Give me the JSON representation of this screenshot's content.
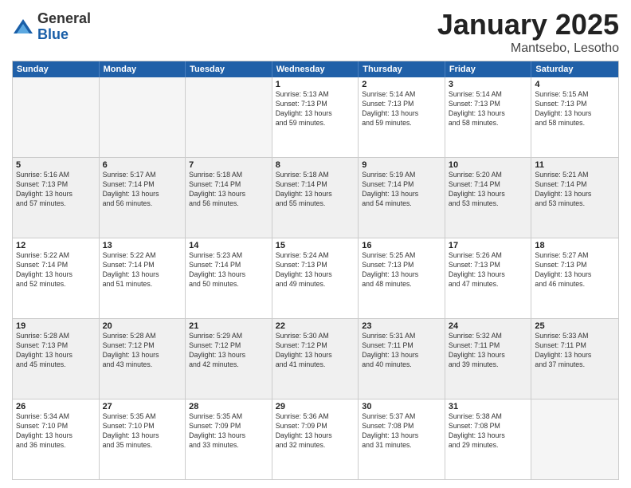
{
  "logo": {
    "general": "General",
    "blue": "Blue"
  },
  "header": {
    "month": "January 2025",
    "location": "Mantsebo, Lesotho"
  },
  "weekdays": [
    "Sunday",
    "Monday",
    "Tuesday",
    "Wednesday",
    "Thursday",
    "Friday",
    "Saturday"
  ],
  "weeks": [
    [
      {
        "day": "",
        "info": ""
      },
      {
        "day": "",
        "info": ""
      },
      {
        "day": "",
        "info": ""
      },
      {
        "day": "1",
        "info": "Sunrise: 5:13 AM\nSunset: 7:13 PM\nDaylight: 13 hours\nand 59 minutes."
      },
      {
        "day": "2",
        "info": "Sunrise: 5:14 AM\nSunset: 7:13 PM\nDaylight: 13 hours\nand 59 minutes."
      },
      {
        "day": "3",
        "info": "Sunrise: 5:14 AM\nSunset: 7:13 PM\nDaylight: 13 hours\nand 58 minutes."
      },
      {
        "day": "4",
        "info": "Sunrise: 5:15 AM\nSunset: 7:13 PM\nDaylight: 13 hours\nand 58 minutes."
      }
    ],
    [
      {
        "day": "5",
        "info": "Sunrise: 5:16 AM\nSunset: 7:13 PM\nDaylight: 13 hours\nand 57 minutes."
      },
      {
        "day": "6",
        "info": "Sunrise: 5:17 AM\nSunset: 7:14 PM\nDaylight: 13 hours\nand 56 minutes."
      },
      {
        "day": "7",
        "info": "Sunrise: 5:18 AM\nSunset: 7:14 PM\nDaylight: 13 hours\nand 56 minutes."
      },
      {
        "day": "8",
        "info": "Sunrise: 5:18 AM\nSunset: 7:14 PM\nDaylight: 13 hours\nand 55 minutes."
      },
      {
        "day": "9",
        "info": "Sunrise: 5:19 AM\nSunset: 7:14 PM\nDaylight: 13 hours\nand 54 minutes."
      },
      {
        "day": "10",
        "info": "Sunrise: 5:20 AM\nSunset: 7:14 PM\nDaylight: 13 hours\nand 53 minutes."
      },
      {
        "day": "11",
        "info": "Sunrise: 5:21 AM\nSunset: 7:14 PM\nDaylight: 13 hours\nand 53 minutes."
      }
    ],
    [
      {
        "day": "12",
        "info": "Sunrise: 5:22 AM\nSunset: 7:14 PM\nDaylight: 13 hours\nand 52 minutes."
      },
      {
        "day": "13",
        "info": "Sunrise: 5:22 AM\nSunset: 7:14 PM\nDaylight: 13 hours\nand 51 minutes."
      },
      {
        "day": "14",
        "info": "Sunrise: 5:23 AM\nSunset: 7:14 PM\nDaylight: 13 hours\nand 50 minutes."
      },
      {
        "day": "15",
        "info": "Sunrise: 5:24 AM\nSunset: 7:13 PM\nDaylight: 13 hours\nand 49 minutes."
      },
      {
        "day": "16",
        "info": "Sunrise: 5:25 AM\nSunset: 7:13 PM\nDaylight: 13 hours\nand 48 minutes."
      },
      {
        "day": "17",
        "info": "Sunrise: 5:26 AM\nSunset: 7:13 PM\nDaylight: 13 hours\nand 47 minutes."
      },
      {
        "day": "18",
        "info": "Sunrise: 5:27 AM\nSunset: 7:13 PM\nDaylight: 13 hours\nand 46 minutes."
      }
    ],
    [
      {
        "day": "19",
        "info": "Sunrise: 5:28 AM\nSunset: 7:13 PM\nDaylight: 13 hours\nand 45 minutes."
      },
      {
        "day": "20",
        "info": "Sunrise: 5:28 AM\nSunset: 7:12 PM\nDaylight: 13 hours\nand 43 minutes."
      },
      {
        "day": "21",
        "info": "Sunrise: 5:29 AM\nSunset: 7:12 PM\nDaylight: 13 hours\nand 42 minutes."
      },
      {
        "day": "22",
        "info": "Sunrise: 5:30 AM\nSunset: 7:12 PM\nDaylight: 13 hours\nand 41 minutes."
      },
      {
        "day": "23",
        "info": "Sunrise: 5:31 AM\nSunset: 7:11 PM\nDaylight: 13 hours\nand 40 minutes."
      },
      {
        "day": "24",
        "info": "Sunrise: 5:32 AM\nSunset: 7:11 PM\nDaylight: 13 hours\nand 39 minutes."
      },
      {
        "day": "25",
        "info": "Sunrise: 5:33 AM\nSunset: 7:11 PM\nDaylight: 13 hours\nand 37 minutes."
      }
    ],
    [
      {
        "day": "26",
        "info": "Sunrise: 5:34 AM\nSunset: 7:10 PM\nDaylight: 13 hours\nand 36 minutes."
      },
      {
        "day": "27",
        "info": "Sunrise: 5:35 AM\nSunset: 7:10 PM\nDaylight: 13 hours\nand 35 minutes."
      },
      {
        "day": "28",
        "info": "Sunrise: 5:35 AM\nSunset: 7:09 PM\nDaylight: 13 hours\nand 33 minutes."
      },
      {
        "day": "29",
        "info": "Sunrise: 5:36 AM\nSunset: 7:09 PM\nDaylight: 13 hours\nand 32 minutes."
      },
      {
        "day": "30",
        "info": "Sunrise: 5:37 AM\nSunset: 7:08 PM\nDaylight: 13 hours\nand 31 minutes."
      },
      {
        "day": "31",
        "info": "Sunrise: 5:38 AM\nSunset: 7:08 PM\nDaylight: 13 hours\nand 29 minutes."
      },
      {
        "day": "",
        "info": ""
      }
    ]
  ]
}
